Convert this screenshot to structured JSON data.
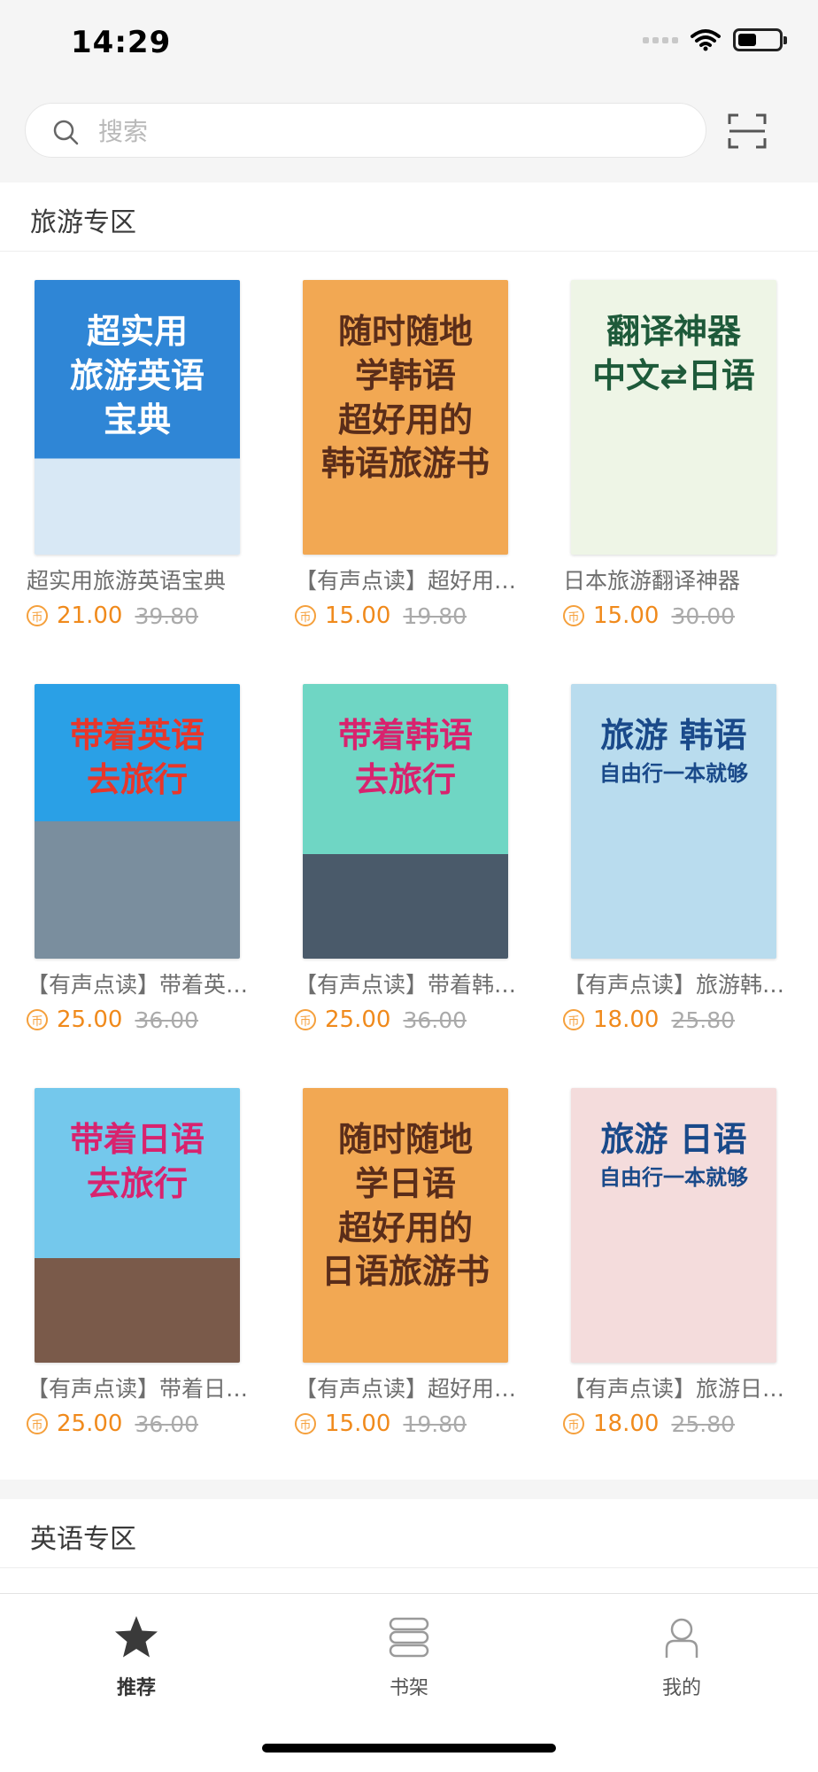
{
  "status_bar": {
    "time": "14:29"
  },
  "search": {
    "placeholder": "搜索"
  },
  "sections": [
    {
      "title": "旅游专区"
    },
    {
      "title": "英语专区"
    }
  ],
  "books": [
    {
      "title": "超实用旅游英语宝典",
      "price": "21.00",
      "old_price": "39.80",
      "cover_text": [
        "超实用",
        "旅游英语",
        "宝典"
      ],
      "cover_theme": "c-blue",
      "cover_color": "#ffffff"
    },
    {
      "title": "【有声点读】超好用的韩语旅游书",
      "price": "15.00",
      "old_price": "19.80",
      "cover_text": [
        "随时随地",
        "学韩语",
        "超好用的",
        "韩语旅游书"
      ],
      "cover_theme": "c-orange",
      "cover_color": "#5a2d1a"
    },
    {
      "title": "日本旅游翻译神器",
      "price": "15.00",
      "old_price": "30.00",
      "cover_text": [
        "翻译神器",
        "中文⇄日语"
      ],
      "cover_theme": "c-green",
      "cover_color": "#1e5a3a"
    },
    {
      "title": "【有声点读】带着英语去旅行",
      "price": "25.00",
      "old_price": "36.00",
      "cover_text": [
        "带着英语",
        "去旅行"
      ],
      "cover_theme": "c-lblue",
      "cover_color": "#e8362a"
    },
    {
      "title": "【有声点读】带着韩语去旅行",
      "price": "25.00",
      "old_price": "36.00",
      "cover_text": [
        "带着韩语",
        "去旅行"
      ],
      "cover_theme": "c-teal",
      "cover_color": "#d8236e"
    },
    {
      "title": "【有声点读】旅游韩语自由行一本就够",
      "price": "18.00",
      "old_price": "25.80",
      "cover_text": [
        "旅游 韩语",
        "自由行一本就够"
      ],
      "cover_theme": "c-korea",
      "cover_color": "#1a4a8a"
    },
    {
      "title": "【有声点读】带着日语去旅行",
      "price": "25.00",
      "old_price": "36.00",
      "cover_text": [
        "带着日语",
        "去旅行"
      ],
      "cover_theme": "c-sky",
      "cover_color": "#d8236e"
    },
    {
      "title": "【有声点读】超好用的日语旅游书",
      "price": "15.00",
      "old_price": "19.80",
      "cover_text": [
        "随时随地",
        "学日语",
        "超好用的",
        "日语旅游书"
      ],
      "cover_theme": "c-orange",
      "cover_color": "#5a2d1a"
    },
    {
      "title": "【有声点读】旅游日语自由行一本就够",
      "price": "18.00",
      "old_price": "25.80",
      "cover_text": [
        "旅游 日语",
        "自由行一本就够"
      ],
      "cover_theme": "c-pink",
      "cover_color": "#1a4a8a"
    }
  ],
  "currency_icon": "币",
  "tabbar": {
    "items": [
      {
        "label": "推荐",
        "icon": "star-icon",
        "active": true
      },
      {
        "label": "书架",
        "icon": "bookshelf-icon",
        "active": false
      },
      {
        "label": "我的",
        "icon": "profile-icon",
        "active": false
      }
    ]
  },
  "colors": {
    "accent": "#f08a1c",
    "active_tab": "#333333",
    "inactive_tab": "#8a8a8a"
  }
}
